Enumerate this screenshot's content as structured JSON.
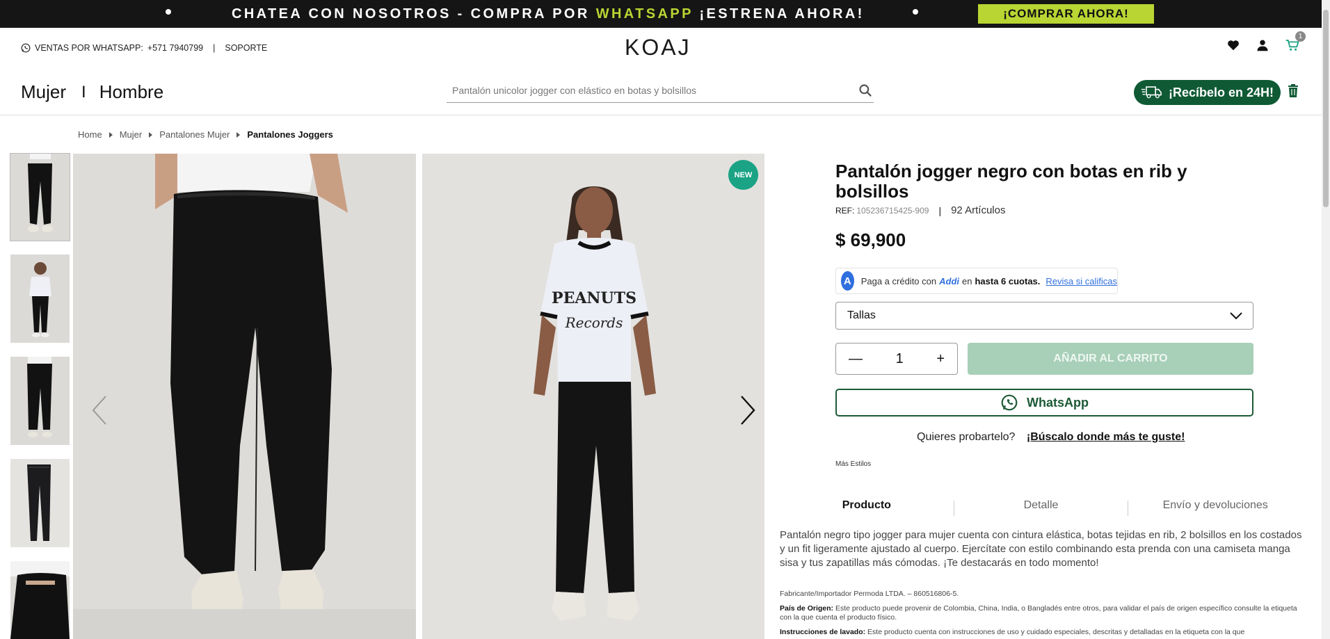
{
  "promo": {
    "message_pre": "CHATEA CON NOSOTROS - COMPRA POR ",
    "message_highlight": "WHATSAPP",
    "message_post": " ¡ESTRENA AHORA!",
    "cta_label": "¡COMPRAR AHORA!",
    "accent_color": "#b9d533"
  },
  "header": {
    "whatsapp_sales_label": "VENTAS POR WHATSAPP:",
    "whatsapp_phone": "+571 7940799",
    "separator": "|",
    "support_label": "SOPORTE",
    "logo": "KOAJ",
    "cart_count": "1",
    "icons": [
      "heart-icon",
      "user-icon",
      "cart-icon"
    ]
  },
  "nav": {
    "women": "Mujer",
    "divider": "I",
    "men": "Hombre"
  },
  "search": {
    "placeholder": "Pantalón unicolor jogger con elástico en botas y bolsillos"
  },
  "delivery": {
    "label": "¡Recíbelo en 24H!",
    "color": "#0f5a35"
  },
  "breadcrumb": [
    "Home",
    "Mujer",
    "Pantalones Mujer",
    "Pantalones Joggers"
  ],
  "gallery": {
    "badge": "NEW",
    "badge_color": "#1aa384",
    "thumbnail_count": 5
  },
  "product": {
    "title": "Pantalón jogger negro con botas en rib y bolsillos",
    "ref_label": "REF:",
    "ref_value": "105236715425-909",
    "ref_pipe": "|",
    "articles": "92 Artículos",
    "price": "$ 69,900"
  },
  "addi": {
    "logo": "A",
    "text_pre": "Paga a crédito con",
    "brand": "Addi",
    "text_mid": "en",
    "installments": "hasta 6 cuotas.",
    "link": "Revisa si calificas"
  },
  "size_select": {
    "label": "Tallas"
  },
  "quantity": {
    "minus": "—",
    "value": "1",
    "plus": "+"
  },
  "add_to_cart": {
    "label": "AÑADIR AL CARRITO",
    "color": "#a8cfb8"
  },
  "whatsapp_button": {
    "label": "WhatsApp"
  },
  "try_on": {
    "question": "Quieres probartelo?",
    "link": "¡Búscalo donde más te guste!"
  },
  "more_styles": "Más Estilos",
  "tabs": [
    "Producto",
    "Detalle",
    "Envío y devoluciones"
  ],
  "description": "Pantalón negro tipo jogger para mujer cuenta con cintura elástica, botas tejidas en rib, 2 bolsillos en los costados y un fit ligeramente ajustado al cuerpo. Ejercítate con estilo combinando esta prenda con una camiseta manga sisa y tus zapatillas más cómodas. ¡Te destacarás en todo momento!",
  "manufacturer": "Fabricante/Importador Permoda LTDA. – 860516806-5.",
  "origin": {
    "label": "País de Origen:",
    "text": "Este producto puede provenir de Colombia, China, India, o Bangladés entre otros, para validar el país de origen específico consulte la etiqueta con la que cuenta el producto físico."
  },
  "washing": {
    "label": "Instrucciones de lavado:",
    "text": "Este producto cuenta con instrucciones de uso y cuidado especiales, descritas y detalladas en la etiqueta con la que"
  }
}
